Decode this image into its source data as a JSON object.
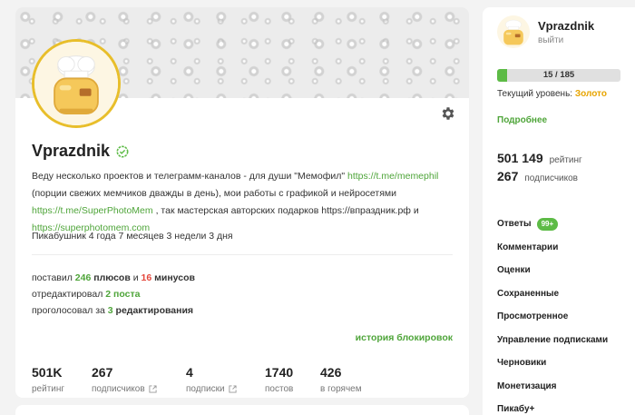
{
  "profile": {
    "username": "Vprazdnik",
    "bio": {
      "t1": "Веду несколько проектов и телеграмм-каналов - для души \"Мемофил\" ",
      "link1": "https://t.me/memephil",
      "t2": " (порции свежих мемчиков дважды в день), мои работы с графикой и нейросетями ",
      "link2": "https://t.me/SuperPhotoMem",
      "t3": " , так мастерская авторских подарков https://впраздник.рф и ",
      "link3": "https://superphotomem.com"
    },
    "tenure": "Пикабушник 4 года 7 месяцев 3 недели 3 дня",
    "activity": {
      "line1_a": "поставил ",
      "pluses": "246",
      "line1_b": " плюсов",
      "line1_and": " и ",
      "minuses": "16",
      "line1_c": " минусов",
      "line2_a": "отредактировал ",
      "line2_b": "2 поста",
      "line3_a": "проголосовал за ",
      "line3_num": "3",
      "line3_b": " редактирования"
    },
    "ban_history": "история блокировок",
    "stats": [
      {
        "value": "501K",
        "label": "рейтинг"
      },
      {
        "value": "267",
        "label": "подписчиков"
      },
      {
        "value": "4",
        "label": "подписки"
      },
      {
        "value": "1740",
        "label": "постов"
      },
      {
        "value": "426",
        "label": "в горячем"
      }
    ]
  },
  "sidebar": {
    "name": "Vprazdnik",
    "logout": "выйти",
    "progress": {
      "text": "15 / 185",
      "fraction": 0.081
    },
    "level_label": "Текущий уровень: ",
    "level_value": "Золото",
    "more": "Подробнее",
    "rating_value": "501 149",
    "rating_label": "рейтинг",
    "subs_value": "267",
    "subs_label": "подписчиков",
    "menu": [
      {
        "label": "Ответы",
        "badge": "99+"
      },
      {
        "label": "Комментарии"
      },
      {
        "label": "Оценки"
      },
      {
        "label": "Сохраненные"
      },
      {
        "label": "Просмотренное"
      },
      {
        "label": "Управление подписками"
      },
      {
        "label": "Черновики"
      },
      {
        "label": "Монетизация"
      },
      {
        "label": "Пикабу+"
      }
    ]
  },
  "colors": {
    "accent_green": "#4fa53a",
    "minus_red": "#e4473c",
    "gold": "#e7a400",
    "avatar_ring": "#e8be2a"
  }
}
